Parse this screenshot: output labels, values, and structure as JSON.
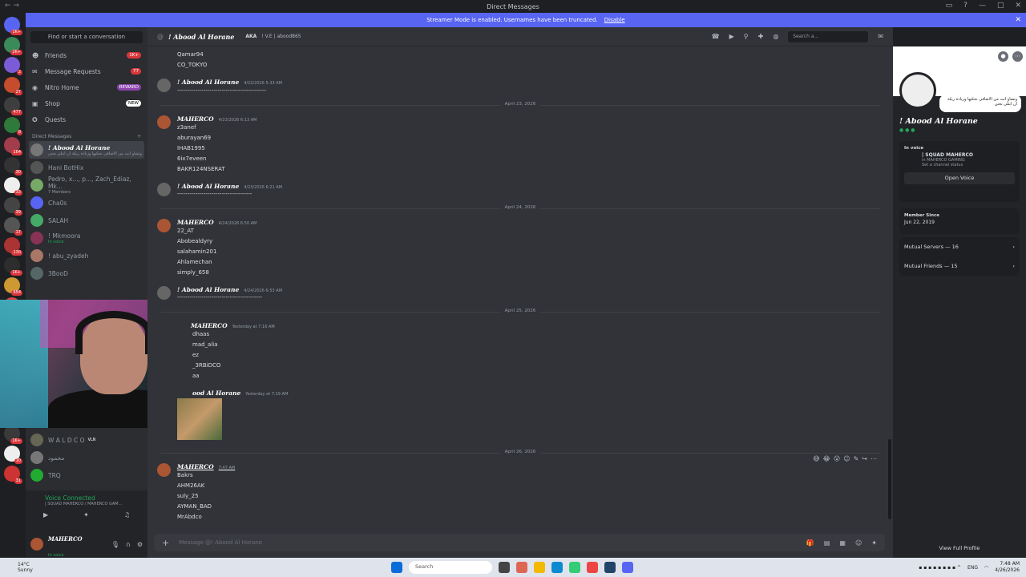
{
  "window": {
    "title": "Direct Messages"
  },
  "banner": {
    "text": "Streamer Mode is enabled. Usernames have been truncated.",
    "disable": "Disable"
  },
  "sidebar": {
    "find": "Find or start a conversation",
    "nav": [
      {
        "label": "Friends",
        "badge": "1K+"
      },
      {
        "label": "Message Requests",
        "badge": "77"
      },
      {
        "label": "Nitro Home",
        "badge": "REWARD"
      },
      {
        "label": "Shop",
        "badge": "NEW"
      },
      {
        "label": "Quests",
        "badge": ""
      }
    ],
    "dm_header": "Direct Messages",
    "dms": [
      {
        "name": "! Abood Al Horane",
        "sub": "وتشاو انت من الاضافي نحكيها وزبادة ريكة ان ابتلي نحتن"
      },
      {
        "name": "Hani BotHix",
        "sub": ""
      },
      {
        "name": "Pedro, x..., p..., Zach_Ediaz, Mk...",
        "sub": "7 Members"
      },
      {
        "name": "Cha0s",
        "sub": ""
      },
      {
        "name": "SALAH",
        "sub": ""
      },
      {
        "name": "! Mkmoora",
        "sub": "In voice"
      },
      {
        "name": "! abu_zyadeh",
        "sub": ""
      },
      {
        "name": "3BooD",
        "sub": ""
      }
    ],
    "dms_lower": [
      {
        "name": "W A L D C O",
        "tag": "VLN"
      },
      {
        "name": "محمود",
        "tag": ""
      },
      {
        "name": "TRQ",
        "tag": ""
      }
    ],
    "voice": {
      "status": "Voice Connected",
      "channel": "| SQUAD MAHERCO / MAHERCO GAM..."
    },
    "user": {
      "name": "MAHERCO",
      "status": "In voice"
    }
  },
  "chat": {
    "header": {
      "name": "! Abood Al Horane",
      "aka": "AKA",
      "aka_value": "! V.E | abood865",
      "search": "Search a..."
    },
    "lines": {
      "l1": "Qamar94",
      "l2": "CO_TOKYO",
      "a1": "! Abood Al Horane",
      "a1ts": "4/22/2026 5:33 AM",
      "a1txt": "--------------------------------------------",
      "d1": "April 23, 2026",
      "m1": "MAHERCO",
      "m1ts": "4/23/2026 6:13 AM",
      "m1a": "z3anef",
      "m1b": "aburayan69",
      "m1c": "IHAB1995",
      "m1d": "6ix7eveen",
      "m1e": "BAKR124NSERAT",
      "a2": "! Abood Al Horane",
      "a2ts": "4/23/2026 6:21 AM",
      "a2txt": "-------------------------------------",
      "d2": "April 24, 2026",
      "m2": "MAHERCO",
      "m2ts": "4/24/2026 6:50 AM",
      "m2a": "22_AT",
      "m2b": "Abobealdyry",
      "m2c": "salahamin201",
      "m2d": "Ahlamechan",
      "m2e": "simply_658",
      "a3": "! Abood Al Horane",
      "a3ts": "4/24/2026 6:53 AM",
      "a3txt": "------------------------------------------",
      "d3": "April 25, 2026",
      "m3": "MAHERCO",
      "m3ts": "Yesterday at 7:16 AM",
      "m3a": "dhaas",
      "m3b": "mad_alia",
      "m3c": "ez",
      "m3d": "_3RBiDCO",
      "m3e": "aa",
      "a4": "ood Al Horane",
      "a4ts": "Yesterday at 7:19 AM",
      "d4": "April 26, 2026",
      "m4": "MAHERCO",
      "m4ts": "7:47 AM",
      "m4a": "Bakrs",
      "m4b": "AHM26AK",
      "m4c": "suly_25",
      "m4d": "AYMAN_BAD",
      "m4e": "MrAbdco"
    },
    "input_placeholder": "Message @! Abood Al Horane"
  },
  "profile": {
    "bubble": "وتشاو انت من الاضافي نحكيها وزبادة ريكة ان ابتلي نحتن",
    "name": "! Abood Al Horane",
    "in_voice_label": "In voice",
    "voice_channel": "| SQUAD MAHERCO",
    "voice_server": "in MAHERCO GAMING",
    "voice_status": "Set a channel status",
    "open_voice": "Open Voice",
    "member_since_label": "Member Since",
    "member_since": "Jun 22, 2019",
    "mutual_servers": "Mutual Servers — 16",
    "mutual_friends": "Mutual Friends — 15",
    "view_full": "View Full Profile"
  },
  "taskbar": {
    "temp": "14°C",
    "weather": "Sunny",
    "search": "Search",
    "lang": "ENG",
    "time": "7:48 AM",
    "date": "4/26/2026"
  }
}
